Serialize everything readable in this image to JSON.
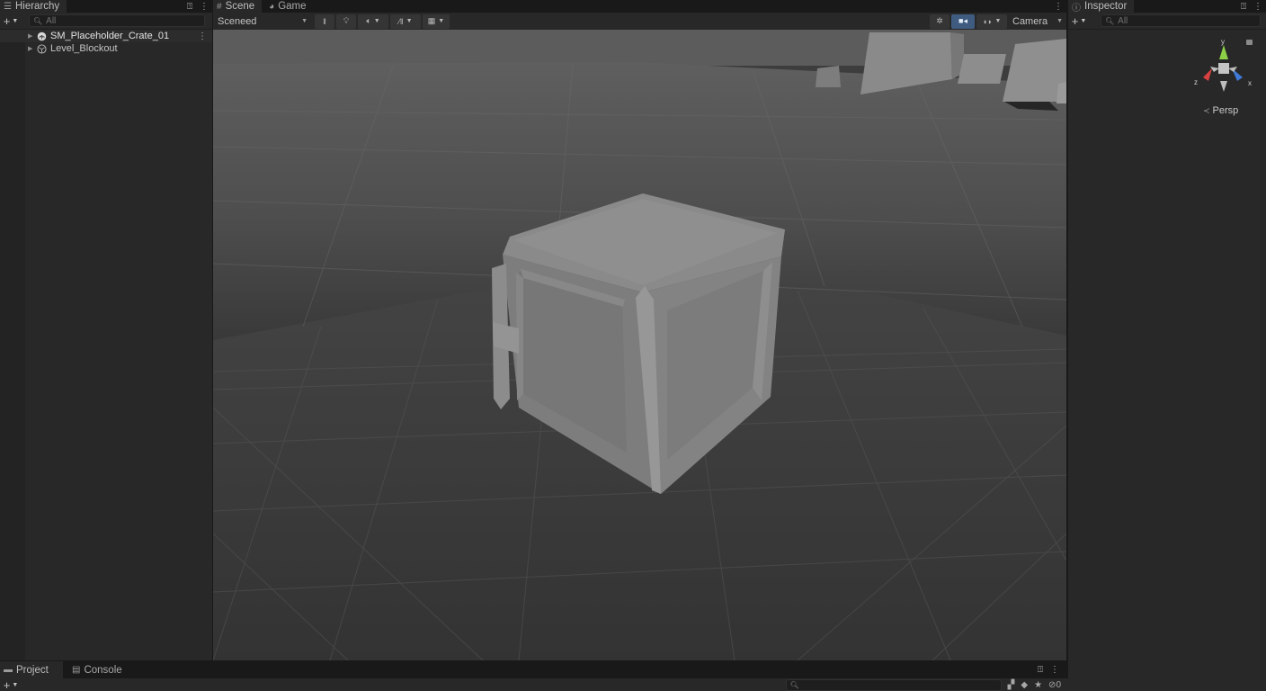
{
  "hierarchy": {
    "tab_label": "Hierarchy",
    "search_placeholder": "All",
    "items": [
      {
        "label": "SM_Placeholder_Crate_01",
        "selected": true,
        "icon": "prefab-icon"
      },
      {
        "label": "Level_Blockout",
        "selected": false,
        "icon": "gameobject-icon"
      }
    ]
  },
  "scene_view": {
    "tabs": [
      {
        "label": "Scene",
        "icon": "grid-icon",
        "active": true
      },
      {
        "label": "Game",
        "icon": "gamepad-icon",
        "active": false
      }
    ],
    "draw_mode": "Sceneed",
    "camera_dropdown": "Camera",
    "projection_label": "Persp",
    "gizmo_axes": {
      "x": "x",
      "y": "y",
      "z": "z"
    },
    "colors": {
      "axis_x": "#d94040",
      "axis_y": "#8cd146",
      "axis_z": "#3f7ad8",
      "active_tool": "#3f5c80"
    }
  },
  "inspector": {
    "tab_label": "Inspector",
    "search_placeholder": "All"
  },
  "bottom": {
    "tabs": [
      {
        "label": "Project",
        "icon": "folder-icon"
      },
      {
        "label": "Console",
        "icon": "console-icon"
      }
    ],
    "hidden_count": "0"
  }
}
